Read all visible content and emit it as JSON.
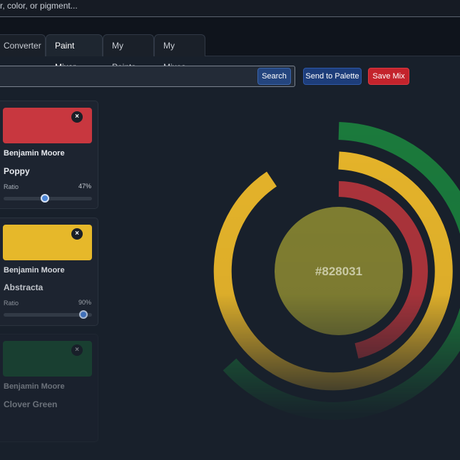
{
  "top_search": {
    "placeholder": "r, color, or pigment..."
  },
  "tabs": [
    {
      "label": "Converter",
      "active": false
    },
    {
      "label": "Paint Mixer",
      "active": true
    },
    {
      "label": "My Paints",
      "active": false
    },
    {
      "label": "My Mixes",
      "active": false
    }
  ],
  "toolbar": {
    "search_label": "Search",
    "send_label": "Send to Palette",
    "save_label": "Save Mix"
  },
  "paints": [
    {
      "brand": "Benjamin Moore",
      "name": "Poppy",
      "ratio_label": "Ratio",
      "ratio_text": "47%",
      "ratio": 0.47,
      "color": "#c8373f",
      "close": "×"
    },
    {
      "brand": "Benjamin Moore",
      "name": "Abstracta",
      "ratio_label": "Ratio",
      "ratio_text": "90%",
      "ratio": 0.9,
      "color": "#e6b82a",
      "close": "×"
    },
    {
      "brand": "Benjamin Moore",
      "name": "Clover Green",
      "color": "#1c6e3b",
      "close": "×"
    }
  ],
  "mix": {
    "hex": "#828031",
    "color": "#828031"
  },
  "colors": {
    "accent": "#24457e",
    "danger": "#c4232c",
    "background": "#18202b"
  }
}
